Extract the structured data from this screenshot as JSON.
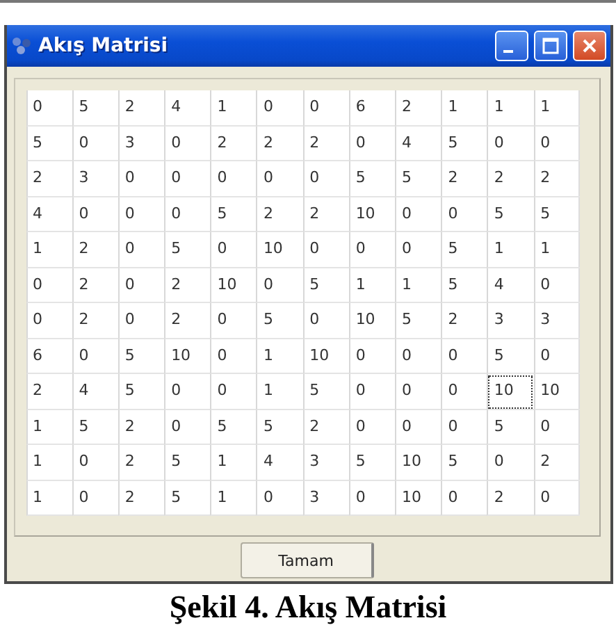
{
  "window": {
    "title": "Akış Matrisi"
  },
  "grid": {
    "rows": [
      [
        {
          "text": "0",
          "focused": false
        },
        {
          "text": "5",
          "focused": false
        },
        {
          "text": "2",
          "focused": false
        },
        {
          "text": "4",
          "focused": false
        },
        {
          "text": "1",
          "focused": false
        },
        {
          "text": "0",
          "focused": false
        },
        {
          "text": "0",
          "focused": false
        },
        {
          "text": "6",
          "focused": false
        },
        {
          "text": "2",
          "focused": false
        },
        {
          "text": "1",
          "focused": false
        },
        {
          "text": "1",
          "focused": false
        },
        {
          "text": "1",
          "focused": false
        }
      ],
      [
        {
          "text": "5",
          "focused": false
        },
        {
          "text": "0",
          "focused": false
        },
        {
          "text": "3",
          "focused": false
        },
        {
          "text": "0",
          "focused": false
        },
        {
          "text": "2",
          "focused": false
        },
        {
          "text": "2",
          "focused": false
        },
        {
          "text": "2",
          "focused": false
        },
        {
          "text": "0",
          "focused": false
        },
        {
          "text": "4",
          "focused": false
        },
        {
          "text": "5",
          "focused": false
        },
        {
          "text": "0",
          "focused": false
        },
        {
          "text": "0",
          "focused": false
        }
      ],
      [
        {
          "text": "2",
          "focused": false
        },
        {
          "text": "3",
          "focused": false
        },
        {
          "text": "0",
          "focused": false
        },
        {
          "text": "0",
          "focused": false
        },
        {
          "text": "0",
          "focused": false
        },
        {
          "text": "0",
          "focused": false
        },
        {
          "text": "0",
          "focused": false
        },
        {
          "text": "5",
          "focused": false
        },
        {
          "text": "5",
          "focused": false
        },
        {
          "text": "2",
          "focused": false
        },
        {
          "text": "2",
          "focused": false
        },
        {
          "text": "2",
          "focused": false
        }
      ],
      [
        {
          "text": "4",
          "focused": false
        },
        {
          "text": "0",
          "focused": false
        },
        {
          "text": "0",
          "focused": false
        },
        {
          "text": "0",
          "focused": false
        },
        {
          "text": "5",
          "focused": false
        },
        {
          "text": "2",
          "focused": false
        },
        {
          "text": "2",
          "focused": false
        },
        {
          "text": "10",
          "focused": false
        },
        {
          "text": "0",
          "focused": false
        },
        {
          "text": "0",
          "focused": false
        },
        {
          "text": "5",
          "focused": false
        },
        {
          "text": "5",
          "focused": false
        }
      ],
      [
        {
          "text": "1",
          "focused": false
        },
        {
          "text": "2",
          "focused": false
        },
        {
          "text": "0",
          "focused": false
        },
        {
          "text": "5",
          "focused": false
        },
        {
          "text": "0",
          "focused": false
        },
        {
          "text": "10",
          "focused": false
        },
        {
          "text": "0",
          "focused": false
        },
        {
          "text": "0",
          "focused": false
        },
        {
          "text": "0",
          "focused": false
        },
        {
          "text": "5",
          "focused": false
        },
        {
          "text": "1",
          "focused": false
        },
        {
          "text": "1",
          "focused": false
        }
      ],
      [
        {
          "text": "0",
          "focused": false
        },
        {
          "text": "2",
          "focused": false
        },
        {
          "text": "0",
          "focused": false
        },
        {
          "text": "2",
          "focused": false
        },
        {
          "text": "10",
          "focused": false
        },
        {
          "text": "0",
          "focused": false
        },
        {
          "text": "5",
          "focused": false
        },
        {
          "text": "1",
          "focused": false
        },
        {
          "text": "1",
          "focused": false
        },
        {
          "text": "5",
          "focused": false
        },
        {
          "text": "4",
          "focused": false
        },
        {
          "text": "0",
          "focused": false
        }
      ],
      [
        {
          "text": "0",
          "focused": false
        },
        {
          "text": "2",
          "focused": false
        },
        {
          "text": "0",
          "focused": false
        },
        {
          "text": "2",
          "focused": false
        },
        {
          "text": "0",
          "focused": false
        },
        {
          "text": "5",
          "focused": false
        },
        {
          "text": "0",
          "focused": false
        },
        {
          "text": "10",
          "focused": false
        },
        {
          "text": "5",
          "focused": false
        },
        {
          "text": "2",
          "focused": false
        },
        {
          "text": "3",
          "focused": false
        },
        {
          "text": "3",
          "focused": false
        }
      ],
      [
        {
          "text": "6",
          "focused": false
        },
        {
          "text": "0",
          "focused": false
        },
        {
          "text": "5",
          "focused": false
        },
        {
          "text": "10",
          "focused": false
        },
        {
          "text": "0",
          "focused": false
        },
        {
          "text": "1",
          "focused": false
        },
        {
          "text": "10",
          "focused": false
        },
        {
          "text": "0",
          "focused": false
        },
        {
          "text": "0",
          "focused": false
        },
        {
          "text": "0",
          "focused": false
        },
        {
          "text": "5",
          "focused": false
        },
        {
          "text": "0",
          "focused": false
        }
      ],
      [
        {
          "text": "2",
          "focused": false
        },
        {
          "text": "4",
          "focused": false
        },
        {
          "text": "5",
          "focused": false
        },
        {
          "text": "0",
          "focused": false
        },
        {
          "text": "0",
          "focused": false
        },
        {
          "text": "1",
          "focused": false
        },
        {
          "text": "5",
          "focused": false
        },
        {
          "text": "0",
          "focused": false
        },
        {
          "text": "0",
          "focused": false
        },
        {
          "text": "0",
          "focused": false
        },
        {
          "text": "10",
          "focused": true
        },
        {
          "text": "10",
          "focused": false
        }
      ],
      [
        {
          "text": "1",
          "focused": false
        },
        {
          "text": "5",
          "focused": false
        },
        {
          "text": "2",
          "focused": false
        },
        {
          "text": "0",
          "focused": false
        },
        {
          "text": "5",
          "focused": false
        },
        {
          "text": "5",
          "focused": false
        },
        {
          "text": "2",
          "focused": false
        },
        {
          "text": "0",
          "focused": false
        },
        {
          "text": "0",
          "focused": false
        },
        {
          "text": "0",
          "focused": false
        },
        {
          "text": "5",
          "focused": false
        },
        {
          "text": "0",
          "focused": false
        }
      ],
      [
        {
          "text": "1",
          "focused": false
        },
        {
          "text": "0",
          "focused": false
        },
        {
          "text": "2",
          "focused": false
        },
        {
          "text": "5",
          "focused": false
        },
        {
          "text": "1",
          "focused": false
        },
        {
          "text": "4",
          "focused": false
        },
        {
          "text": "3",
          "focused": false
        },
        {
          "text": "5",
          "focused": false
        },
        {
          "text": "10",
          "focused": false
        },
        {
          "text": "5",
          "focused": false
        },
        {
          "text": "0",
          "focused": false
        },
        {
          "text": "2",
          "focused": false
        }
      ],
      [
        {
          "text": "1",
          "focused": false
        },
        {
          "text": "0",
          "focused": false
        },
        {
          "text": "2",
          "focused": false
        },
        {
          "text": "5",
          "focused": false
        },
        {
          "text": "1",
          "focused": false
        },
        {
          "text": "0",
          "focused": false
        },
        {
          "text": "3",
          "focused": false
        },
        {
          "text": "0",
          "focused": false
        },
        {
          "text": "10",
          "focused": false
        },
        {
          "text": "0",
          "focused": false
        },
        {
          "text": "2",
          "focused": false
        },
        {
          "text": "0",
          "focused": false
        }
      ]
    ]
  },
  "buttons": [
    "Tamam"
  ],
  "caption": "Şekil 4. Akış Matrisi"
}
